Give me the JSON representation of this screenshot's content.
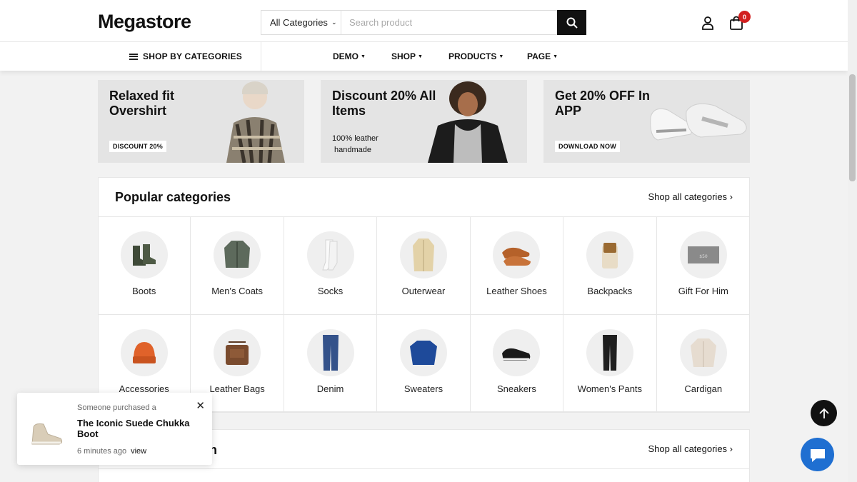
{
  "header": {
    "logo": "Megastore",
    "search_category": "All Categories",
    "search_placeholder": "Search product",
    "cart_count": "0"
  },
  "nav": {
    "shop_by": "SHOP BY CATEGORIES",
    "links": [
      "DEMO",
      "SHOP",
      "PRODUCTS",
      "PAGE"
    ]
  },
  "banners": [
    {
      "title": "Relaxed fit Overshirt",
      "tag": "DISCOUNT 20%"
    },
    {
      "title": "Discount 20% All Items",
      "text1": "100% leather",
      "text2": "handmade"
    },
    {
      "title": "Get 20% OFF In APP",
      "tag": "DOWNLOAD NOW"
    }
  ],
  "popular": {
    "title": "Popular categories",
    "link": "Shop all categories ›",
    "items": [
      "Boots",
      "Men's Coats",
      "Socks",
      "Outerwear",
      "Leather Shoes",
      "Backpacks",
      "Gift For Him",
      "Accessories",
      "Leather Bags",
      "Denim",
      "Sweaters",
      "Sneakers",
      "Women's Pants",
      "Cardigan"
    ]
  },
  "section2": {
    "title_visible": "ion",
    "link": "Shop all categories ›"
  },
  "popup": {
    "top": "Someone purchased a",
    "product": "The Iconic Suede Chukka Boot",
    "time": "6 minutes ago",
    "view": "view"
  },
  "colors": {
    "accent_dark": "#111111",
    "badge_red": "#d21f1f",
    "chat_blue": "#1f6fd1",
    "page_bg": "#f2f2f2"
  }
}
